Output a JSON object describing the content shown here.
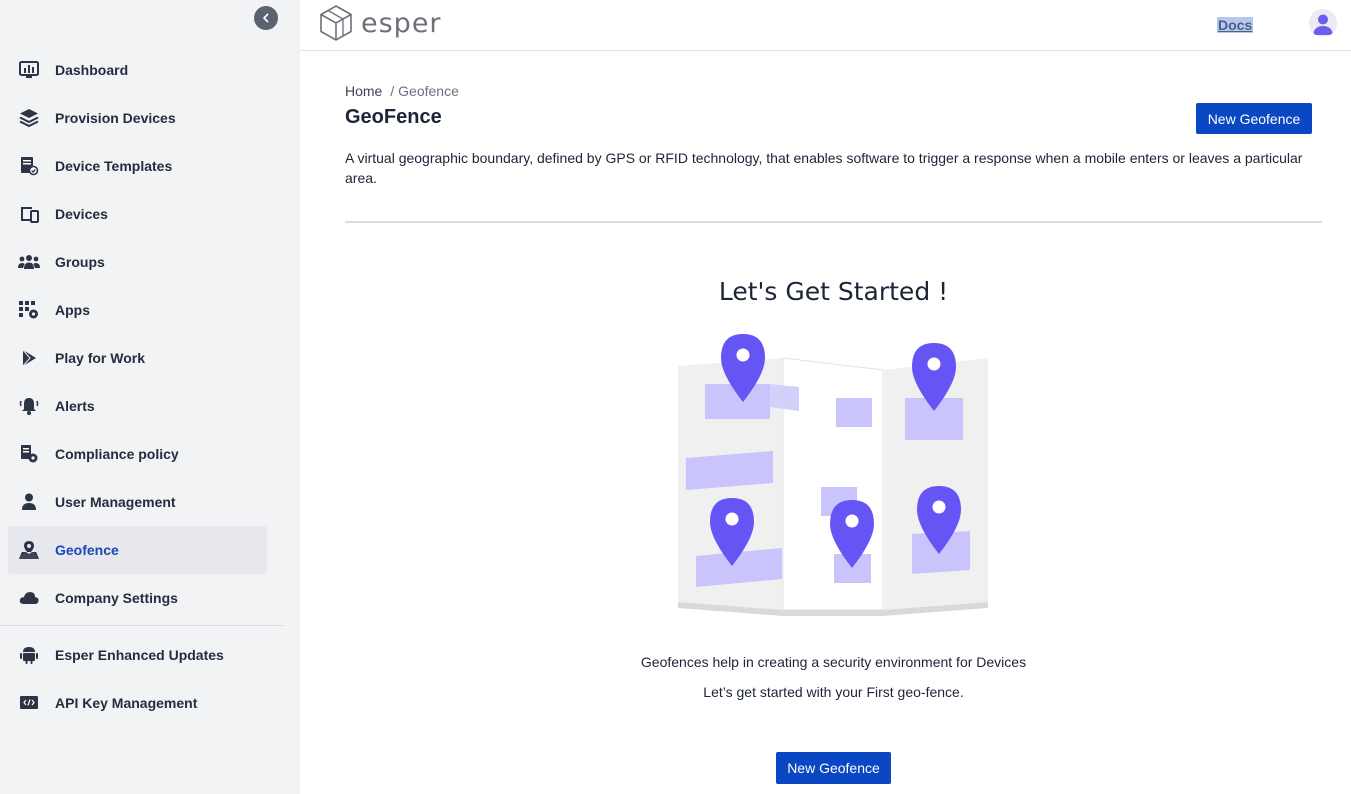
{
  "app": {
    "logo_text": "esper",
    "docs_label": "Docs"
  },
  "sidebar": {
    "items": [
      {
        "label": "Dashboard",
        "icon": "dashboard-icon"
      },
      {
        "label": "Provision Devices",
        "icon": "provision-icon"
      },
      {
        "label": "Device Templates",
        "icon": "template-icon"
      },
      {
        "label": "Devices",
        "icon": "devices-icon"
      },
      {
        "label": "Groups",
        "icon": "groups-icon"
      },
      {
        "label": "Apps",
        "icon": "apps-icon"
      },
      {
        "label": "Play for Work",
        "icon": "play-icon"
      },
      {
        "label": "Alerts",
        "icon": "bell-icon"
      },
      {
        "label": "Compliance policy",
        "icon": "compliance-icon"
      },
      {
        "label": "User Management",
        "icon": "user-icon"
      },
      {
        "label": "Geofence",
        "icon": "geofence-icon",
        "active": true
      },
      {
        "label": "Company Settings",
        "icon": "cloud-icon"
      }
    ],
    "secondary": [
      {
        "label": "Esper Enhanced Updates",
        "icon": "android-icon"
      },
      {
        "label": "API Key Management",
        "icon": "code-icon"
      }
    ]
  },
  "breadcrumb": {
    "home": "Home",
    "current": "/ Geofence"
  },
  "page": {
    "title": "GeoFence",
    "new_button": "New Geofence",
    "description": "A virtual geographic boundary, defined by GPS or RFID technology, that enables software to trigger a response when a mobile enters or leaves a particular area."
  },
  "empty_state": {
    "heading": "Let's Get Started !",
    "line1": "Geofences help in creating a security environment for Devices",
    "line2": "Let’s get started with your First geo-fence.",
    "button": "New Geofence"
  },
  "colors": {
    "accent": "#0a47c2",
    "pin": "#6655f5",
    "active_text": "#1d46b8"
  }
}
